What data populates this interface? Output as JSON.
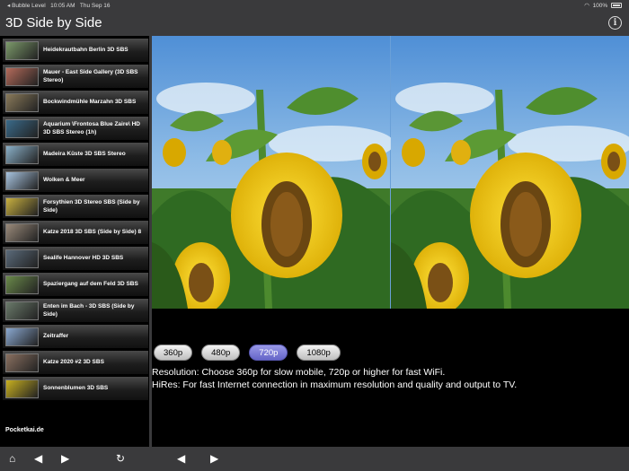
{
  "status_bar": {
    "back_app": "◂ Bubble Level",
    "time": "10:05 AM",
    "date": "Thu Sep 16",
    "wifi_icon": "wifi-icon",
    "battery": "100%"
  },
  "nav": {
    "title": "3D Side by Side",
    "info_icon": "info-icon"
  },
  "videos": [
    {
      "title": "Heidekrautbahn Berlin 3D SBS",
      "thumb": "#7c9a6a"
    },
    {
      "title": "Mauer - East Side Gallery (3D SBS Stereo)",
      "thumb": "#b46a5a"
    },
    {
      "title": "Bockwindmühle Marzahn 3D SBS",
      "thumb": "#8a7a5a"
    },
    {
      "title": "Aquarium \\Frontosa Blue Zaire\\ HD 3D SBS Stereo (1h)",
      "thumb": "#3a6a8a"
    },
    {
      "title": "Madeira Küste 3D SBS Stereo",
      "thumb": "#8ab0c8"
    },
    {
      "title": "Wolken & Meer",
      "thumb": "#a8c4e0"
    },
    {
      "title": "Forsythien 3D Stereo SBS (Side by Side)",
      "thumb": "#c8b040"
    },
    {
      "title": "Katze 2018 3D SBS (Side by Side) 8",
      "thumb": "#9a8a7a"
    },
    {
      "title": "Sealife Hannover HD 3D SBS",
      "thumb": "#5a6a7a"
    },
    {
      "title": "Spaziergang auf dem Feld 3D SBS",
      "thumb": "#6a8a4a"
    },
    {
      "title": "Enten im Bach - 3D SBS (Side by Side)",
      "thumb": "#6a7a6a"
    },
    {
      "title": "Zeitraffer",
      "thumb": "#8aa8d0"
    },
    {
      "title": "Katze 2020 #2 3D SBS",
      "thumb": "#8a7060"
    },
    {
      "title": "Sonnenblumen 3D SBS",
      "thumb": "#c8b020"
    }
  ],
  "footer_link": "Pocketkai.de",
  "resolutions": [
    {
      "label": "360p",
      "active": false
    },
    {
      "label": "480p",
      "active": false
    },
    {
      "label": "720p",
      "active": true
    },
    {
      "label": "1080p",
      "active": false
    }
  ],
  "description": {
    "line1": "Resolution: Choose 360p for slow mobile, 720p or higher for fast WiFi.",
    "line2": "HiRes: For fast Internet connection in maximum resolution and quality and output to TV."
  },
  "toolbar": {
    "home_icon": "home-icon",
    "prev_icon": "prev-arrow-icon",
    "next_icon": "next-arrow-icon",
    "reload_icon": "reload-icon",
    "back_icon": "back-arrow-icon",
    "forward_icon": "forward-arrow-icon"
  },
  "colors": {
    "bar": "#3a3a3c",
    "active_button": "#7373d6"
  }
}
